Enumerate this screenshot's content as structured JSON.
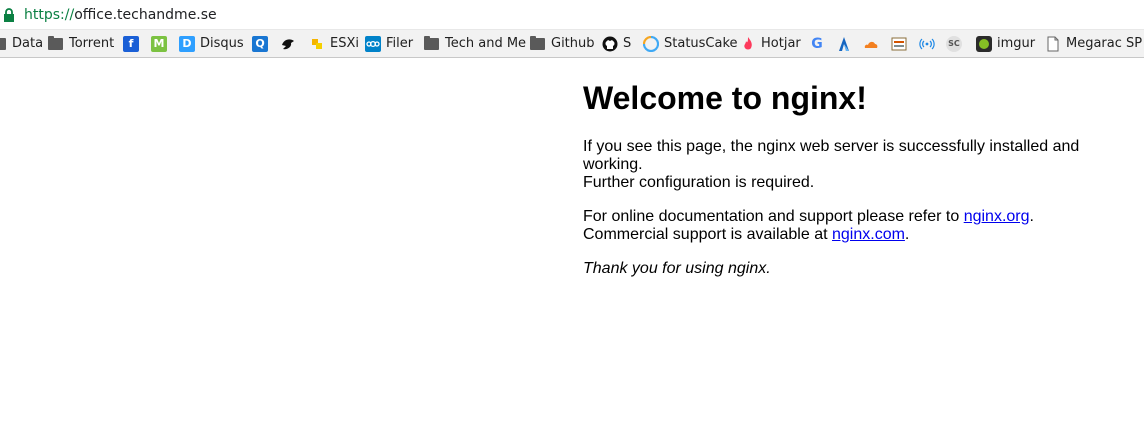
{
  "address_bar": {
    "scheme": "https://",
    "host": "office.techandme.se"
  },
  "bookmarks": [
    {
      "label": "Data",
      "icon": "folder-icon"
    },
    {
      "label": "Torrent",
      "icon": "folder-icon"
    },
    {
      "label": "",
      "icon": "app-icon-blue"
    },
    {
      "label": "",
      "icon": "m-icon-green"
    },
    {
      "label": "Disqus",
      "icon": "disqus-icon"
    },
    {
      "label": "",
      "icon": "q-icon-blue"
    },
    {
      "label": "",
      "icon": "bird-icon"
    },
    {
      "label": "ESXi",
      "icon": "esxi-icon"
    },
    {
      "label": "Filer",
      "icon": "nextcloud-icon"
    },
    {
      "label": "Tech and Me",
      "icon": "folder-icon"
    },
    {
      "label": "Github",
      "icon": "folder-icon"
    },
    {
      "label": "S",
      "icon": "github-icon"
    },
    {
      "label": "StatusCake",
      "icon": "statuscake-icon"
    },
    {
      "label": "Hotjar",
      "icon": "hotjar-icon"
    },
    {
      "label": "",
      "icon": "google-icon"
    },
    {
      "label": "",
      "icon": "a-icon-blue"
    },
    {
      "label": "",
      "icon": "cloudflare-icon"
    },
    {
      "label": "",
      "icon": "tool-icon"
    },
    {
      "label": "",
      "icon": "wifi-icon"
    },
    {
      "label": "",
      "icon": "sc-icon"
    },
    {
      "label": "imgur",
      "icon": "imgur-icon"
    },
    {
      "label": "Megarac SP",
      "icon": "page-icon"
    }
  ],
  "page": {
    "heading": "Welcome to nginx!",
    "p1_line1": "If you see this page, the nginx web server is successfully installed and working.",
    "p1_line2": "Further configuration is required.",
    "p2_prefix": "For online documentation and support please refer to ",
    "p2_link": "nginx.org",
    "p2_suffix": ".",
    "p2_line2_prefix": "Commercial support is available at ",
    "p2_line2_link": "nginx.com",
    "p2_line2_suffix": ".",
    "p3": "Thank you for using nginx."
  },
  "colors": {
    "link": "#0000ee",
    "secure_green": "#0b8043",
    "bookmark_bar_bg": "#f2f2f2"
  }
}
